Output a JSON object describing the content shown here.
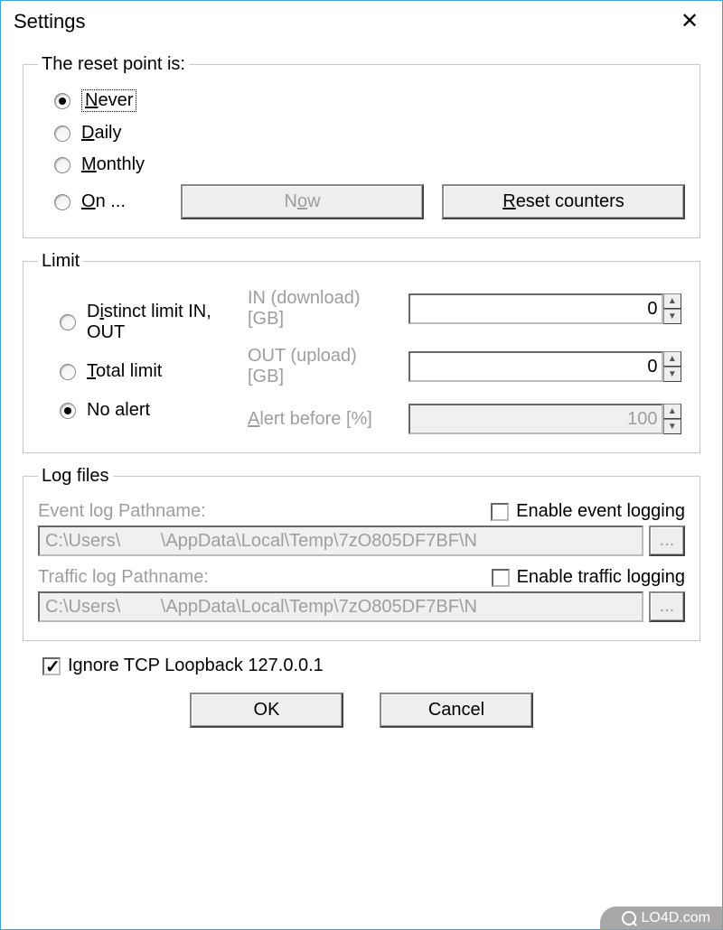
{
  "title": "Settings",
  "reset": {
    "legend": "The reset point is:",
    "options": {
      "never": "Never",
      "daily": "Daily",
      "monthly": "Monthly",
      "on": "On ..."
    },
    "selected": "never",
    "now_btn": "Now",
    "reset_counters_btn": "Reset counters"
  },
  "limit": {
    "legend": "Limit",
    "in_label": "IN (download) [GB]",
    "in_value": "0",
    "out_label": "OUT (upload) [GB]",
    "out_value": "0",
    "alert_label": "Alert before [%]",
    "alert_value": "100",
    "options": {
      "distinct": "Distinct limit IN, OUT",
      "total": "Total limit",
      "noalert": "No alert"
    },
    "selected": "noalert"
  },
  "logs": {
    "legend": "Log files",
    "event_label": "Event log Pathname:",
    "enable_event": "Enable event logging",
    "event_path": "C:\\Users\\        \\AppData\\Local\\Temp\\7zO805DF7BF\\N",
    "traffic_label": "Traffic log Pathname:",
    "enable_traffic": "Enable traffic logging",
    "traffic_path": "C:\\Users\\        \\AppData\\Local\\Temp\\7zO805DF7BF\\N",
    "browse": "..."
  },
  "ignore_loopback": "Ignore TCP Loopback 127.0.0.1",
  "ignore_loopback_checked": true,
  "footer": {
    "ok": "OK",
    "cancel": "Cancel"
  },
  "watermark": "LO4D.com"
}
